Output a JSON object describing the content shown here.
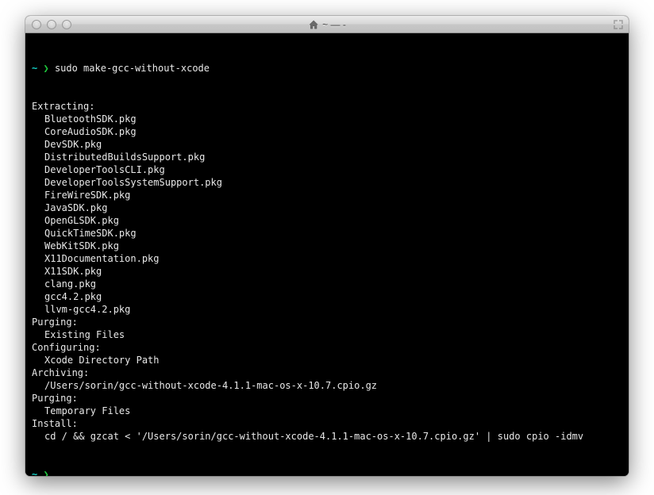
{
  "window": {
    "title": "~ — -"
  },
  "prompt": {
    "dir": "~",
    "arrow": "❯"
  },
  "command": "sudo make-gcc-without-xcode",
  "output": {
    "sections": [
      {
        "header": "Extracting:",
        "items": [
          "BluetoothSDK.pkg",
          "CoreAudioSDK.pkg",
          "DevSDK.pkg",
          "DistributedBuildsSupport.pkg",
          "DeveloperToolsCLI.pkg",
          "DeveloperToolsSystemSupport.pkg",
          "FireWireSDK.pkg",
          "JavaSDK.pkg",
          "OpenGLSDK.pkg",
          "QuickTimeSDK.pkg",
          "WebKitSDK.pkg",
          "X11Documentation.pkg",
          "X11SDK.pkg",
          "clang.pkg",
          "gcc4.2.pkg",
          "llvm-gcc4.2.pkg"
        ]
      },
      {
        "header": "Purging:",
        "items": [
          "Existing Files"
        ]
      },
      {
        "header": "Configuring:",
        "items": [
          "Xcode Directory Path"
        ]
      },
      {
        "header": "Archiving:",
        "items": [
          "/Users/sorin/gcc-without-xcode-4.1.1-mac-os-x-10.7.cpio.gz"
        ]
      },
      {
        "header": "Purging:",
        "items": [
          "Temporary Files"
        ]
      },
      {
        "header": "Install:",
        "items": [
          "cd / && gzcat < '/Users/sorin/gcc-without-xcode-4.1.1-mac-os-x-10.7.cpio.gz' | sudo cpio -idmv"
        ]
      }
    ]
  }
}
